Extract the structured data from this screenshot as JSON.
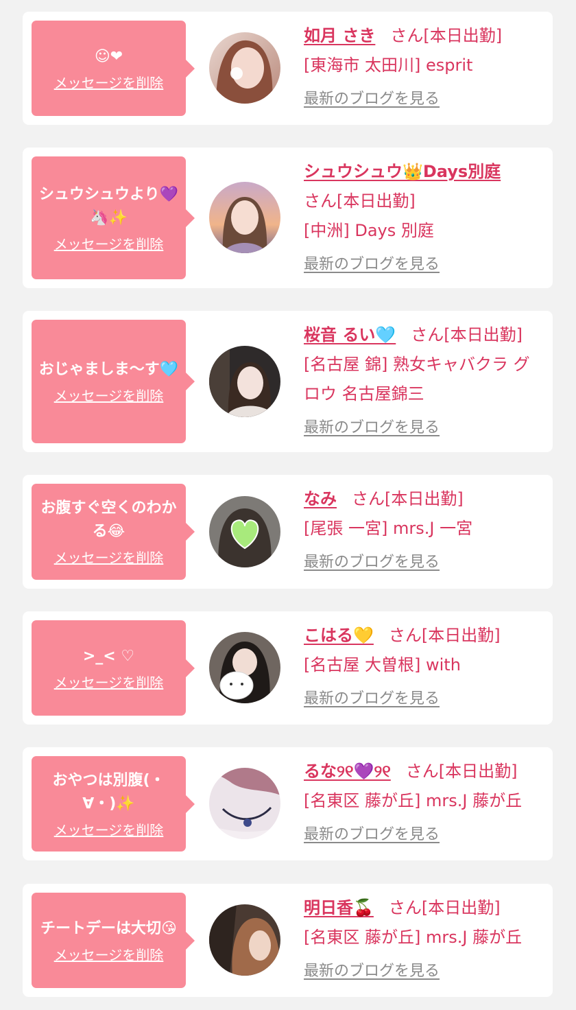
{
  "delete_label": "メッセージを削除",
  "blog_label": "最新のブログを見る",
  "cards": [
    {
      "message": "☺❤",
      "name": "如月 さき",
      "status": "さん[本日出勤]",
      "shop": "[東海市 太田川] esprit"
    },
    {
      "message": "シュウシュウより💜🦄✨",
      "name": "シュウシュウ👑Days別庭",
      "status": "さん[本日出勤]",
      "shop": "[中洲] Days 別庭"
    },
    {
      "message": "おじゃましま〜す🩵",
      "name": "桜音 るい🩵",
      "status": "さん[本日出勤]",
      "shop": "[名古屋 錦] 熟女キャバクラ グロウ 名古屋錦三"
    },
    {
      "message": "お腹すぐ空くのわかる😂",
      "name": "なみ",
      "status": "さん[本日出勤]",
      "shop": "[尾張 一宮] mrs.J 一宮"
    },
    {
      "message": ">_< ♡",
      "name": "こはる💛",
      "status": "さん[本日出勤]",
      "shop": "[名古屋 大曽根] with"
    },
    {
      "message": "おやつは別腹(・∀・)✨",
      "name": "るな୨୧💜୨୧",
      "status": "さん[本日出勤]",
      "shop": "[名東区 藤が丘] mrs.J 藤が丘"
    },
    {
      "message": "チートデーは大切😘",
      "name": "明日香🍒",
      "status": "さん[本日出勤]",
      "shop": "[名東区 藤が丘] mrs.J 藤が丘"
    }
  ]
}
